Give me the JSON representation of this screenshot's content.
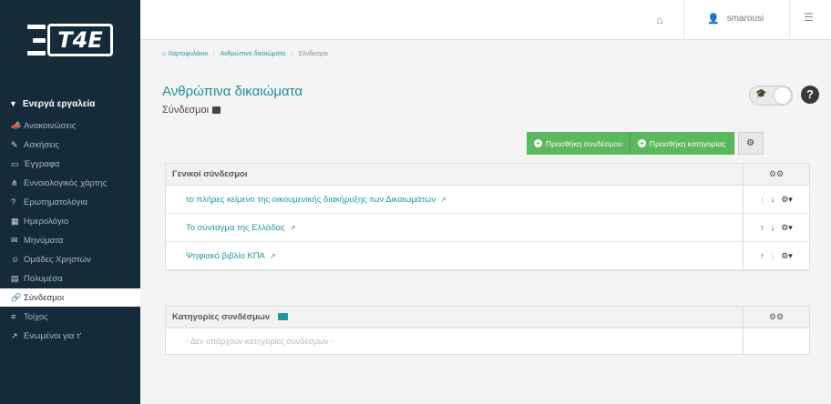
{
  "logo": {
    "text": "T4E"
  },
  "sidebar": {
    "tools_header": "Ενεργά εργαλεία",
    "items": [
      {
        "label": "Ανακοινώσεις",
        "icon": "megaphone-icon"
      },
      {
        "label": "Ασκήσεις",
        "icon": "edit-icon"
      },
      {
        "label": "Έγγραφα",
        "icon": "folder-icon"
      },
      {
        "label": "Εννοιολογικός χάρτης",
        "icon": "sitemap-icon"
      },
      {
        "label": "Ερωτηματολόγια",
        "icon": "question-icon"
      },
      {
        "label": "Ημερολόγιο",
        "icon": "calendar-icon"
      },
      {
        "label": "Μηνύματα",
        "icon": "envelope-icon"
      },
      {
        "label": "Ομάδες Χρηστών",
        "icon": "users-icon"
      },
      {
        "label": "Πολυμέσα",
        "icon": "film-icon"
      },
      {
        "label": "Σύνδεσμοι",
        "icon": "link-icon",
        "active": true
      },
      {
        "label": "Τοίχος",
        "icon": "list-icon"
      },
      {
        "label": "Ενωμένοι για τ'",
        "icon": "external-icon"
      }
    ]
  },
  "topbar": {
    "username": "smarousi"
  },
  "breadcrumb": [
    "Χαρτοφυλάκιο",
    "Ανθρώπινα δικαιώματα",
    "Σύνδεσμοι"
  ],
  "page": {
    "title": "Ανθρώπινα δικαιώματα",
    "subtitle": "Σύνδεσμοι"
  },
  "actions": {
    "add_link": "Προσθήκη συνδέσμου",
    "add_category": "Προσθήκη κατηγορίας"
  },
  "links_panel": {
    "title": "Γενικοί σύνδεσμοι",
    "links": [
      "το πλήρες κείμενο της οικουμενικής διακήρυξης των Δικαιωμάτων",
      "Το σύνταγμα της Ελλάδας",
      "Ψηφιακό βιβλίο ΚΠΑ"
    ]
  },
  "categories_panel": {
    "title": "Κατηγορίες συνδέσμων",
    "empty_text": "- Δεν υπάρχουν κατηγορίες συνδέσμων -"
  },
  "colors": {
    "sidebar": "#152b3a",
    "accent": "#1c9aa0",
    "green": "#5cb85c"
  }
}
